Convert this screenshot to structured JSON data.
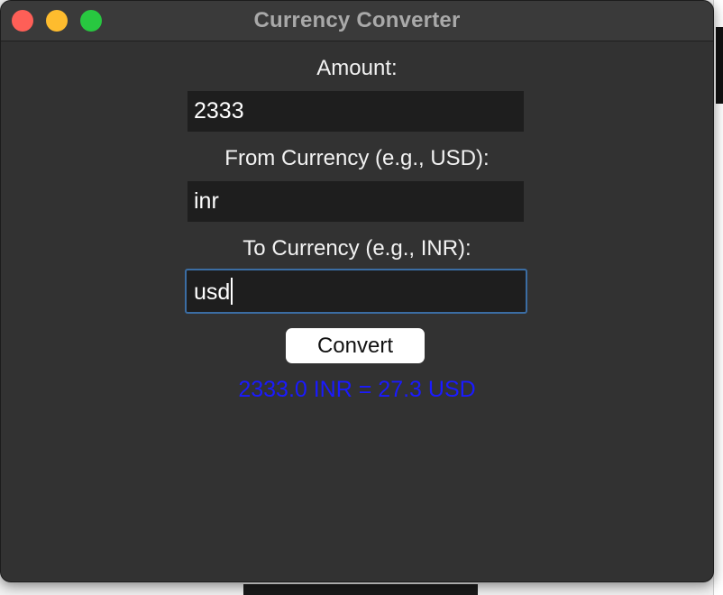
{
  "window": {
    "title": "Currency Converter"
  },
  "form": {
    "amount_label": "Amount:",
    "amount_value": "2333",
    "from_label": "From Currency (e.g., USD):",
    "from_value": "inr",
    "to_label": "To Currency (e.g., INR):",
    "to_value": "usd",
    "convert_label": "Convert"
  },
  "result": {
    "text": "2333.0 INR = 27.3 USD",
    "color": "#1a1aff"
  },
  "colors": {
    "window_bg": "#323232",
    "field_bg": "#1e1e1e",
    "focus_ring": "#3b6da3"
  }
}
